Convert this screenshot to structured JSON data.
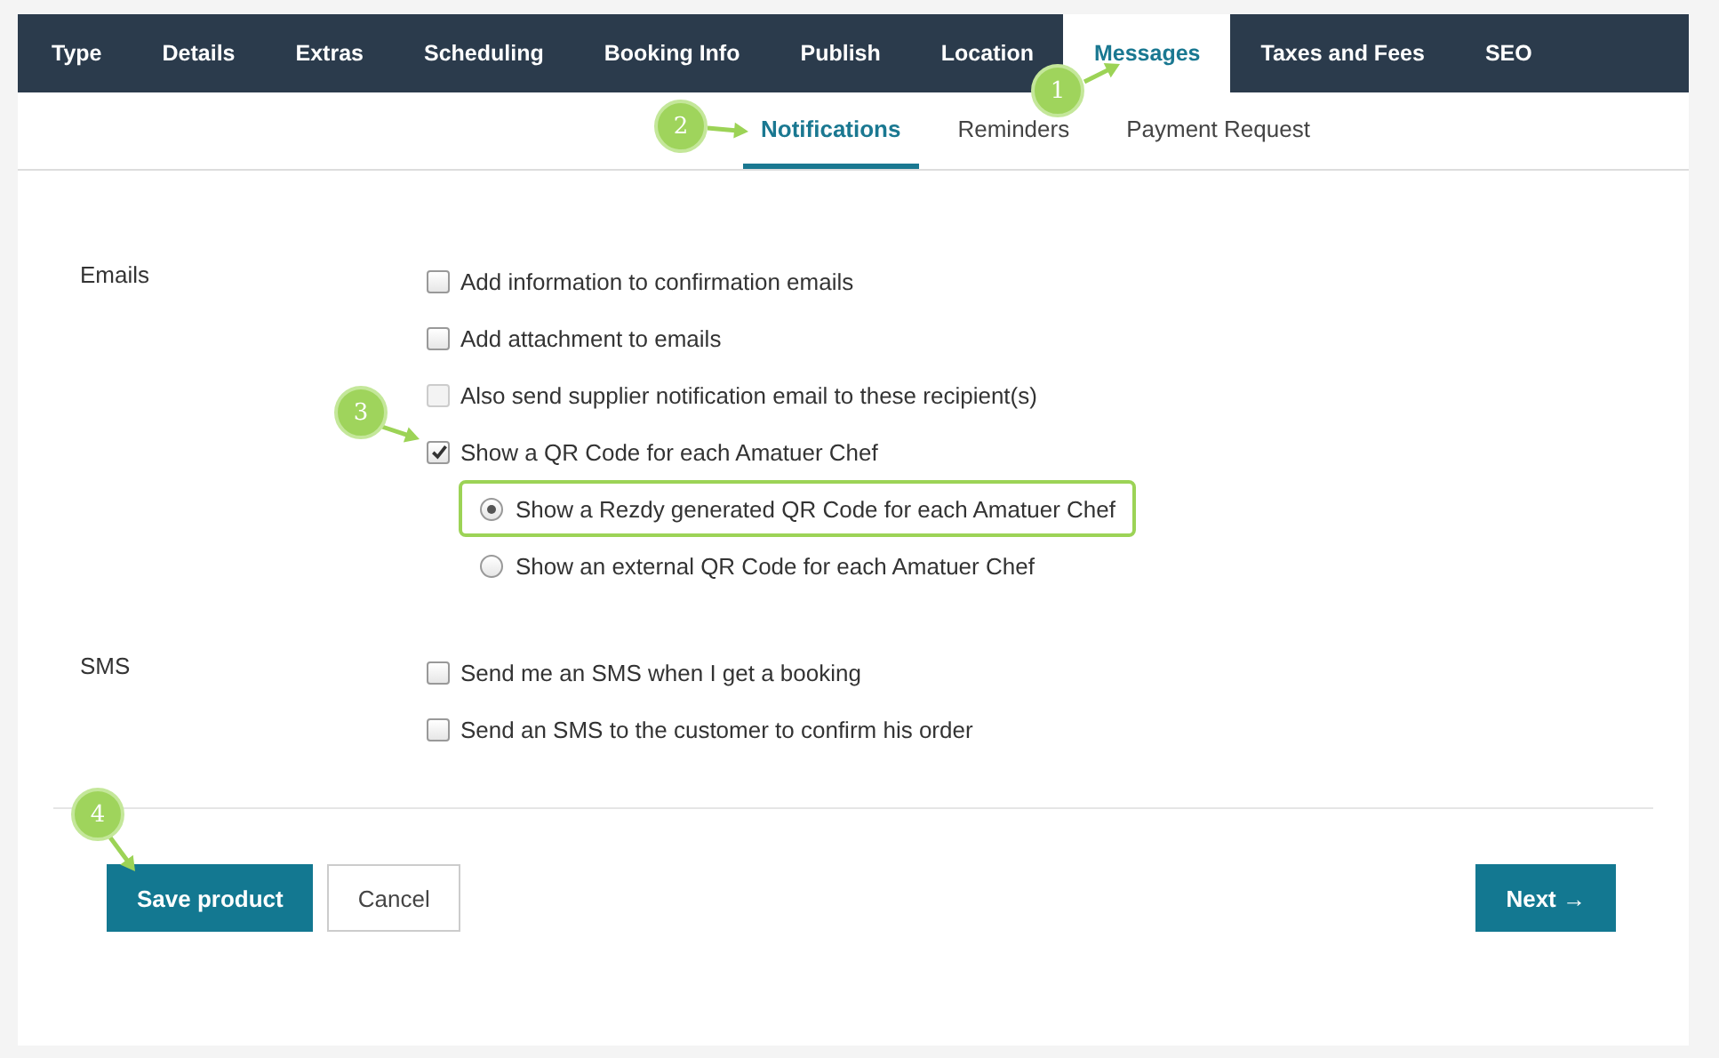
{
  "tabs": [
    {
      "label": "Type",
      "selected": false
    },
    {
      "label": "Details",
      "selected": false
    },
    {
      "label": "Extras",
      "selected": false
    },
    {
      "label": "Scheduling",
      "selected": false
    },
    {
      "label": "Booking Info",
      "selected": false
    },
    {
      "label": "Publish",
      "selected": false
    },
    {
      "label": "Location",
      "selected": false
    },
    {
      "label": "Messages",
      "selected": true
    },
    {
      "label": "Taxes and Fees",
      "selected": false
    },
    {
      "label": "SEO",
      "selected": false
    }
  ],
  "subtabs": [
    {
      "label": "Notifications",
      "selected": true
    },
    {
      "label": "Reminders",
      "selected": false
    },
    {
      "label": "Payment Request",
      "selected": false
    }
  ],
  "sections": [
    {
      "label": "Emails",
      "options": [
        {
          "kind": "checkbox",
          "label": "Add information to confirmation emails",
          "checked": false,
          "disabled": false
        },
        {
          "kind": "checkbox",
          "label": "Add attachment to emails",
          "checked": false,
          "disabled": false
        },
        {
          "kind": "checkbox",
          "label": "Also send supplier notification email to these recipient(s)",
          "checked": false,
          "disabled": true
        },
        {
          "kind": "checkbox",
          "label": "Show a QR Code for each Amatuer Chef",
          "checked": true,
          "disabled": false
        },
        {
          "kind": "radio",
          "label": "Show a Rezdy generated QR Code for each Amatuer Chef",
          "selected": true,
          "highlighted": true
        },
        {
          "kind": "radio",
          "label": "Show an external QR Code for each Amatuer Chef",
          "selected": false,
          "highlighted": false
        }
      ]
    },
    {
      "label": "SMS",
      "options": [
        {
          "kind": "checkbox",
          "label": "Send me an SMS when I get a booking",
          "checked": false,
          "disabled": false
        },
        {
          "kind": "checkbox",
          "label": "Send an SMS to the customer to confirm his order",
          "checked": false,
          "disabled": false
        }
      ]
    }
  ],
  "actions_left": [
    {
      "kind": "primary",
      "label": "Save product"
    },
    {
      "kind": "secondary",
      "label": "Cancel"
    }
  ],
  "actions_right": [
    {
      "kind": "primary",
      "label": "Next →"
    }
  ],
  "callouts": [
    "1",
    "2",
    "3",
    "4"
  ]
}
